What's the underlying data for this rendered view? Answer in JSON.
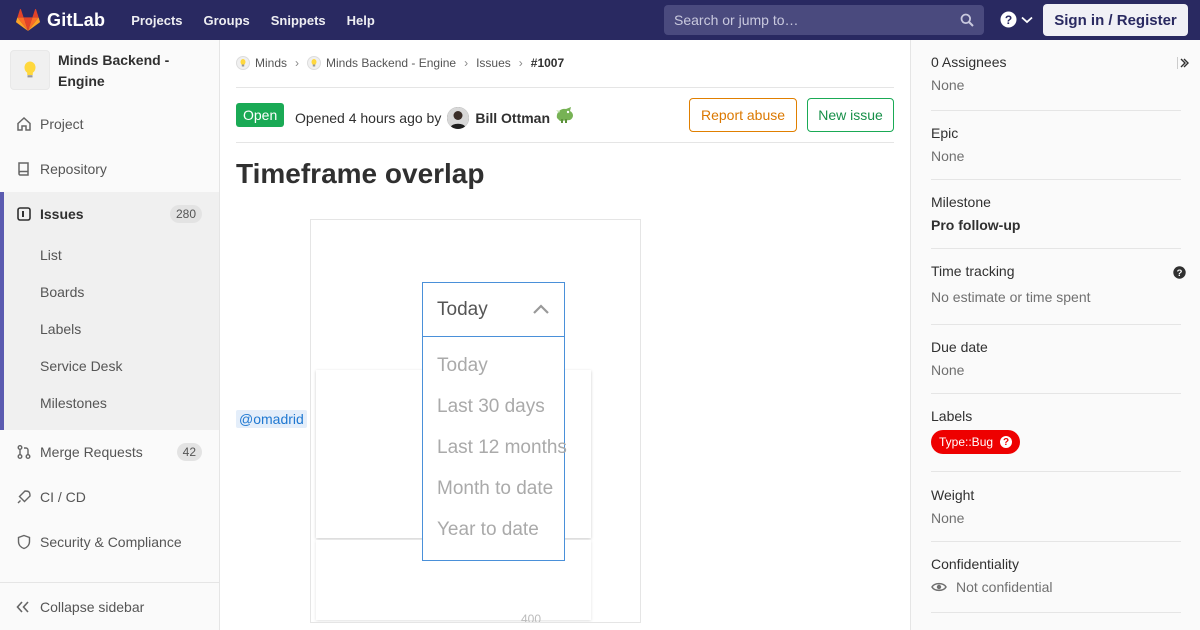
{
  "navbar": {
    "brand": "GitLab",
    "links": [
      "Projects",
      "Groups",
      "Snippets",
      "Help"
    ],
    "search_placeholder": "Search or jump to…",
    "signin_label": "Sign in / Register"
  },
  "sidebar": {
    "project_name": "Minds Backend - Engine",
    "items": {
      "project": "Project",
      "repository": "Repository",
      "issues": "Issues",
      "issues_count": "280",
      "merge_requests": "Merge Requests",
      "merge_requests_count": "42",
      "cicd": "CI / CD",
      "security": "Security & Compliance"
    },
    "issue_sub": [
      "List",
      "Boards",
      "Labels",
      "Service Desk",
      "Milestones"
    ],
    "collapse_label": "Collapse sidebar"
  },
  "breadcrumb": {
    "group": "Minds",
    "project": "Minds Backend - Engine",
    "section": "Issues",
    "current": "#1007"
  },
  "issue": {
    "status": "Open",
    "opened_text": "Opened 4 hours ago by",
    "author": "Bill Ottman",
    "report_abuse_label": "Report abuse",
    "new_issue_label": "New issue",
    "title": "Timeframe overlap",
    "mention": "@omadrid"
  },
  "embedded": {
    "selected": "Today",
    "options": [
      "Today",
      "Last 30 days",
      "Last 12 months",
      "Month to date",
      "Year to date"
    ],
    "partial_number": "400"
  },
  "right_sidebar": {
    "assignees_title": "0 Assignees",
    "assignees_value": "None",
    "epic_title": "Epic",
    "epic_value": "None",
    "milestone_title": "Milestone",
    "milestone_value": "Pro follow-up",
    "time_title": "Time tracking",
    "time_value": "No estimate or time spent",
    "due_title": "Due date",
    "due_value": "None",
    "labels_title": "Labels",
    "label_name": "Type::Bug",
    "label_color": "#ee0000",
    "weight_title": "Weight",
    "weight_value": "None",
    "conf_title": "Confidentiality",
    "conf_value": "Not confidential"
  }
}
